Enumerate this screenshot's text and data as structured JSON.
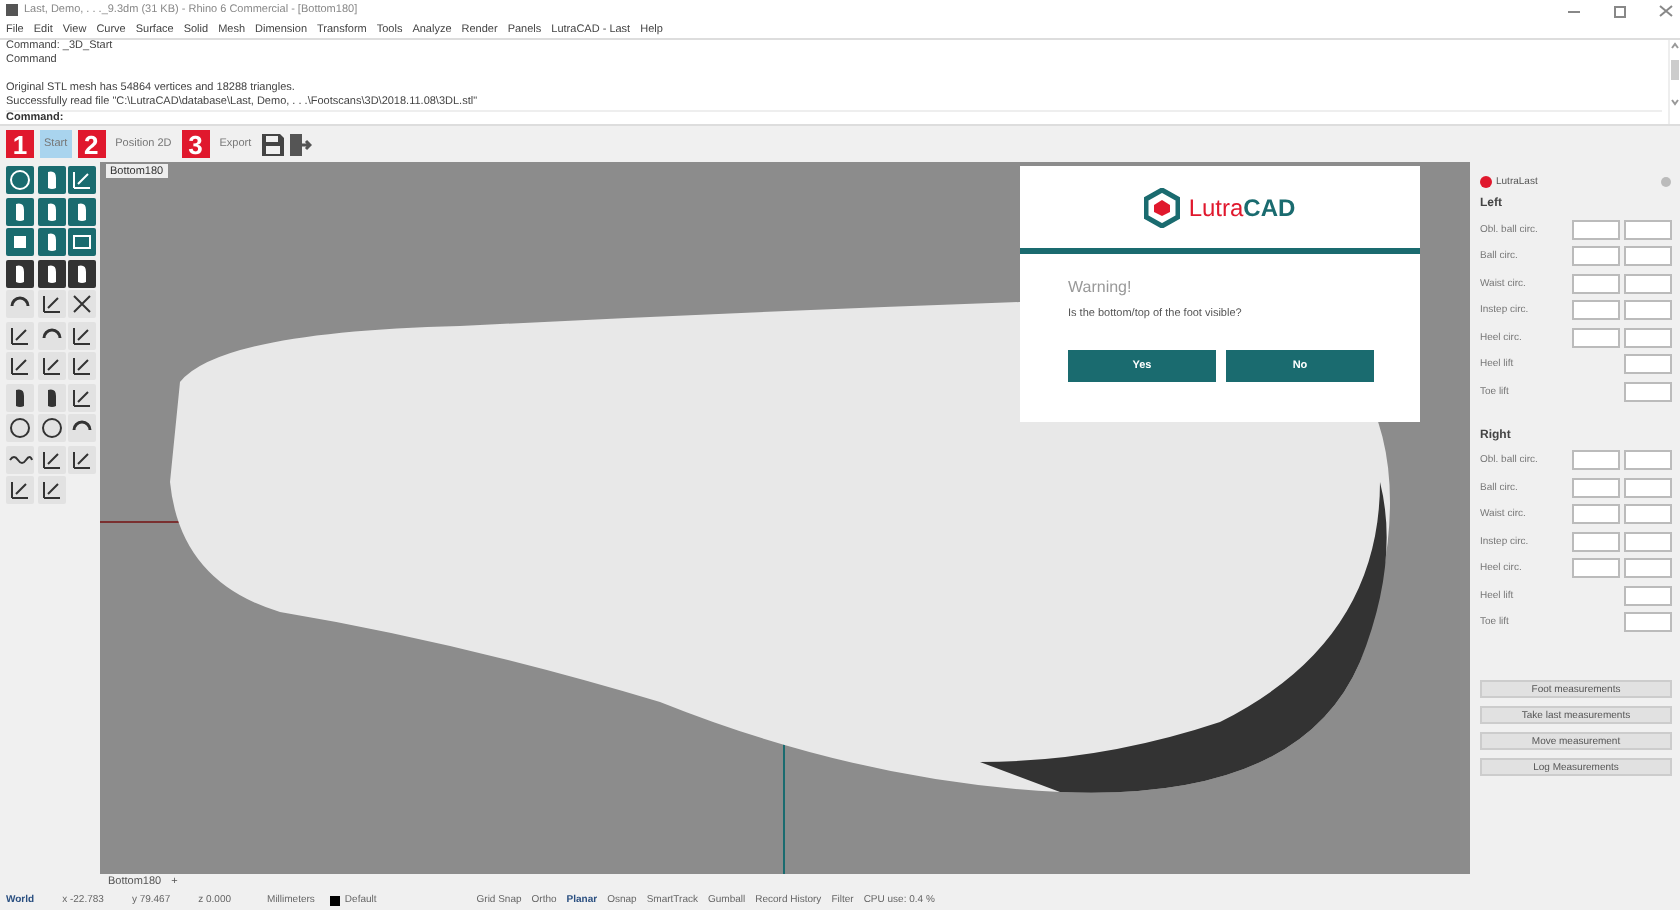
{
  "window": {
    "title": "Last, Demo, . . ._9.3dm (31 KB) - Rhino 6 Commercial - [Bottom180]"
  },
  "menu": [
    "File",
    "Edit",
    "View",
    "Curve",
    "Surface",
    "Solid",
    "Mesh",
    "Dimension",
    "Transform",
    "Tools",
    "Analyze",
    "Render",
    "Panels",
    "LutraCAD - Last",
    "Help"
  ],
  "command_history": [
    "Command: _3D_Start",
    "Command"
  ],
  "command_output": [
    "Original STL mesh has 54864 vertices and 18288 triangles.",
    "Successfully read file \"C:\\LutraCAD\\database\\Last, Demo, . . .\\Footscans\\3D\\2018.11.08\\3DL.stl\""
  ],
  "command_prompt": "Command:",
  "steps": [
    {
      "number": "1",
      "label": "Start",
      "selected": true
    },
    {
      "number": "2",
      "label": "Position 2D",
      "selected": false
    },
    {
      "number": "3",
      "label": "Export",
      "selected": false
    }
  ],
  "viewport": {
    "title": "Bottom180",
    "tab": "Bottom180",
    "add_tab": "+"
  },
  "dialog": {
    "logo_light": "Lutra",
    "logo_bold": "CAD",
    "title": "Warning!",
    "message": "Is the bottom/top of the foot visible?",
    "buttons": [
      "Yes",
      "No"
    ]
  },
  "panel": {
    "title": "LutraLast",
    "sections": [
      {
        "title": "Left",
        "rows": [
          {
            "label": "Obl. ball circ.",
            "kind": "pair"
          },
          {
            "label": "Ball circ.",
            "kind": "pair"
          },
          {
            "label": "Waist circ.",
            "kind": "pair"
          },
          {
            "label": "Instep circ.",
            "kind": "pair"
          },
          {
            "label": "Heel circ.",
            "kind": "pair"
          },
          {
            "label": "Heel lift",
            "kind": "single"
          },
          {
            "label": "Toe lift",
            "kind": "single"
          }
        ]
      },
      {
        "title": "Right",
        "rows": [
          {
            "label": "Obl. ball circ.",
            "kind": "pair"
          },
          {
            "label": "Ball circ.",
            "kind": "pair"
          },
          {
            "label": "Waist circ.",
            "kind": "pair"
          },
          {
            "label": "Instep circ.",
            "kind": "pair"
          },
          {
            "label": "Heel circ.",
            "kind": "pair"
          },
          {
            "label": "Heel lift",
            "kind": "single"
          },
          {
            "label": "Toe lift",
            "kind": "single"
          }
        ]
      }
    ],
    "buttons": [
      "Foot measurements",
      "Take last measurements",
      "Move measurement",
      "Log Measurements"
    ]
  },
  "status_bar": {
    "cplane": "World",
    "x": "x -22.783",
    "y": "y 79.467",
    "z": "z 0.000",
    "units": "Millimeters",
    "layer": "Default",
    "toggles": [
      {
        "label": "Grid Snap",
        "on": false
      },
      {
        "label": "Ortho",
        "on": false
      },
      {
        "label": "Planar",
        "on": true
      },
      {
        "label": "Osnap",
        "on": false
      },
      {
        "label": "SmartTrack",
        "on": false
      },
      {
        "label": "Gumball",
        "on": false
      },
      {
        "label": "Record History",
        "on": false
      },
      {
        "label": "Filter",
        "on": false
      }
    ],
    "cpu": "CPU use: 0.4 %"
  }
}
